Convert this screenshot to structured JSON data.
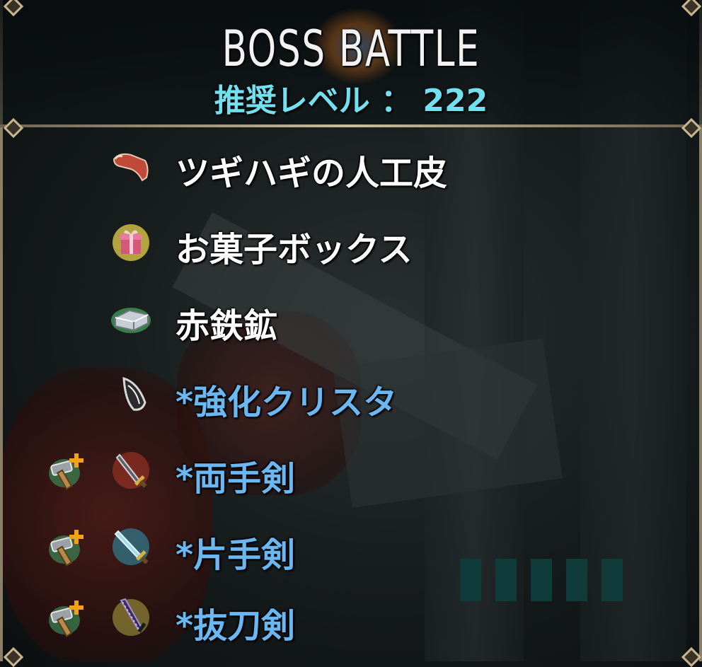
{
  "header": {
    "title": "BOSS BATTLE",
    "recommended_level": "推奨レベル ： 222"
  },
  "rewards": [
    {
      "label": "ツギハギの人工皮",
      "icon": "patchwork-leather-icon",
      "special": false
    },
    {
      "label": "お菓子ボックス",
      "icon": "gift-box-icon",
      "special": false
    },
    {
      "label": "赤鉄鉱",
      "icon": "ingot-icon",
      "special": false
    },
    {
      "label": "*強化クリスタ",
      "icon": "crystal-icon",
      "special": true
    },
    {
      "label": "*両手剣",
      "icon": "two-handed-sword-icon",
      "special": true,
      "craft_icon": "smith-hammer-plus-icon"
    },
    {
      "label": "*片手剣",
      "icon": "one-handed-sword-icon",
      "special": true,
      "craft_icon": "smith-hammer-plus-icon"
    },
    {
      "label": "*抜刀剣",
      "icon": "katana-icon",
      "special": true,
      "craft_icon": "smith-hammer-plus-icon"
    }
  ],
  "colors": {
    "title": "#f2f2f2",
    "level": "#72e0ee",
    "normal_item": "#ffffff",
    "special_item": "#6ab7f2",
    "frame": "#c8b68e"
  }
}
